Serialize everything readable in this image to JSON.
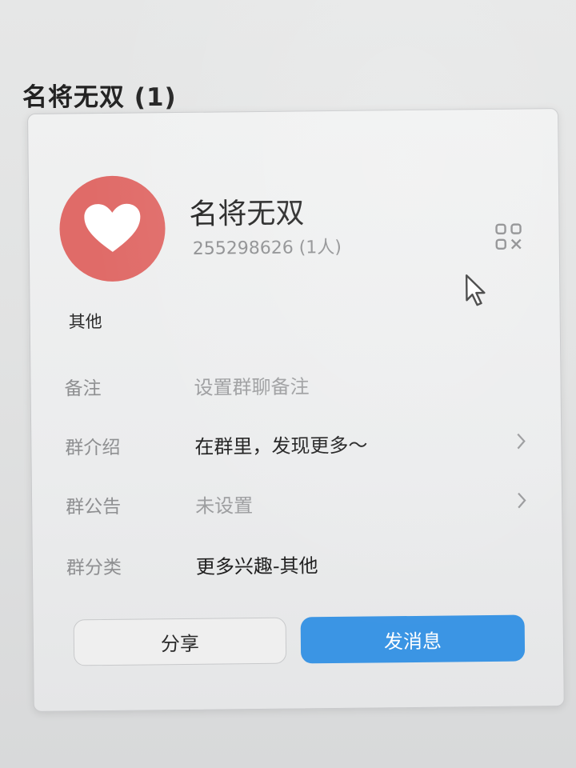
{
  "header": {
    "title": "名将无双 (1)"
  },
  "profile": {
    "name": "名将无双",
    "id_line": "255298626 (1人)",
    "category_tag": "其他"
  },
  "rows": [
    {
      "label": "备注",
      "value": "设置群聊备注",
      "style": "placeholder",
      "chevron": false
    },
    {
      "label": "群介绍",
      "value": "在群里，发现更多～",
      "style": "filled",
      "chevron": true
    },
    {
      "label": "群公告",
      "value": "未设置",
      "style": "placeholder",
      "chevron": true
    },
    {
      "label": "群分类",
      "value": "更多兴趣-其他",
      "style": "filled",
      "chevron": false
    }
  ],
  "buttons": {
    "share_label": "分享",
    "send_label": "发消息"
  },
  "colors": {
    "avatar": "#e06b68",
    "accent": "#3b95e4"
  },
  "icons": {
    "avatar": "heart-icon",
    "qr": "qr-code-icon",
    "row_arrow": "chevron-right-icon",
    "pointer": "mouse-cursor-icon"
  }
}
